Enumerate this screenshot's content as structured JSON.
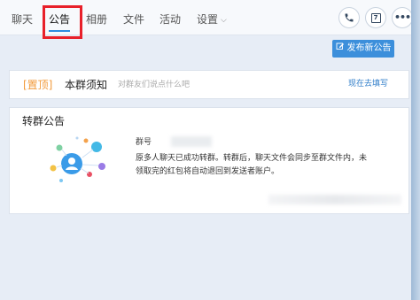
{
  "tabs": [
    {
      "label": "聊天"
    },
    {
      "label": "公告"
    },
    {
      "label": "相册"
    },
    {
      "label": "文件"
    },
    {
      "label": "活动"
    },
    {
      "label": "设置"
    }
  ],
  "active_tab": "公告",
  "toolbar": {
    "phone_icon": "phone-icon",
    "calendar_icon": "calendar-icon",
    "calendar_day": "7",
    "more_icon": "more-icon"
  },
  "publish_button": {
    "label": "发布新公告"
  },
  "pinned": {
    "tag": "[置顶]",
    "title": "本群须知",
    "placeholder": "对群友们说点什么吧",
    "action": "现在去填写"
  },
  "notice": {
    "heading": "转群公告",
    "group_label": "群号",
    "lines": [
      "原多人聊天已成功转群。转群后，聊天文件会同步至群文件内，未",
      "领取完的红包将自动退回到发送者账户。"
    ]
  },
  "colors": {
    "accent": "#3c8fdb",
    "pin_tag": "#f29a3a",
    "highlight": "#e8202a"
  }
}
